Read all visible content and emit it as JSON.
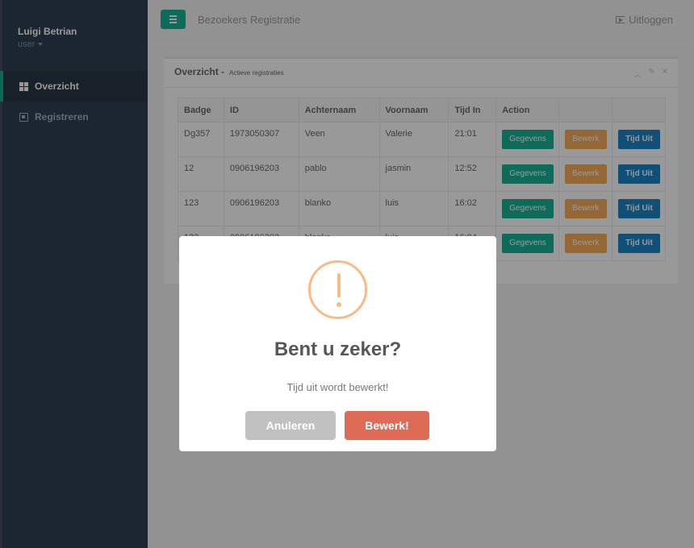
{
  "sidebar": {
    "user_name": "Luigi Betrian",
    "user_role": "user",
    "items": [
      {
        "label": "Overzicht",
        "icon": "grid-icon",
        "active": true
      },
      {
        "label": "Registreren",
        "icon": "registration-icon",
        "active": false
      }
    ]
  },
  "topbar": {
    "title": "Bezoekers Registratie",
    "logout_label": "Uitloggen"
  },
  "panel": {
    "title": "Overzicht -",
    "subtitle": "Actieve registraties",
    "columns": [
      "Badge",
      "ID",
      "Achternaam",
      "Voornaam",
      "Tijd In",
      "Action"
    ],
    "rows": [
      {
        "badge": "Dg357",
        "id": "1973050307",
        "achternaam": "Veen",
        "voornaam": "Valerie",
        "tijd_in": "21:01"
      },
      {
        "badge": "12",
        "id": "0906196203",
        "achternaam": "pablo",
        "voornaam": "jasmin",
        "tijd_in": "12:52"
      },
      {
        "badge": "123",
        "id": "0906196203",
        "achternaam": "blanko",
        "voornaam": "luis",
        "tijd_in": "16:02"
      },
      {
        "badge": "123",
        "id": "0906196203",
        "achternaam": "blanko",
        "voornaam": "luis",
        "tijd_in": "16:04"
      }
    ],
    "buttons": {
      "details": "Gegevens",
      "edit": "Bewerk",
      "time_out": "Tijd Uit"
    }
  },
  "modal": {
    "title": "Bent u zeker?",
    "text": "Tijd uit wordt bewerkt!",
    "cancel_label": "Anuleren",
    "confirm_label": "Bewerk!"
  },
  "colors": {
    "sidebar": "#2f4050",
    "accent": "#1ab394",
    "warning": "#f8bb86",
    "confirm": "#dd6b55",
    "cancel": "#c1c1c1"
  }
}
